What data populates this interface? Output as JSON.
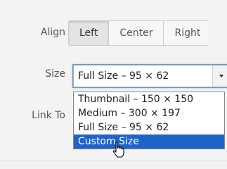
{
  "align": {
    "label": "Align",
    "options": [
      "Left",
      "Center",
      "Right"
    ],
    "selected": "Left"
  },
  "size": {
    "label": "Size",
    "value": "Full Size – 95 × 62",
    "options": [
      "Thumbnail – 150 × 150",
      "Medium – 300 × 197",
      "Full Size – 95 × 62",
      "Custom Size"
    ],
    "highlighted": "Custom Size"
  },
  "link_to": {
    "label": "Link To"
  },
  "colors": {
    "highlight": "#1e63c8",
    "focus_ring": "#5b9dd9"
  },
  "icons": {
    "dropdown": "chevron-down-icon",
    "cursor": "hand-pointer-icon"
  }
}
